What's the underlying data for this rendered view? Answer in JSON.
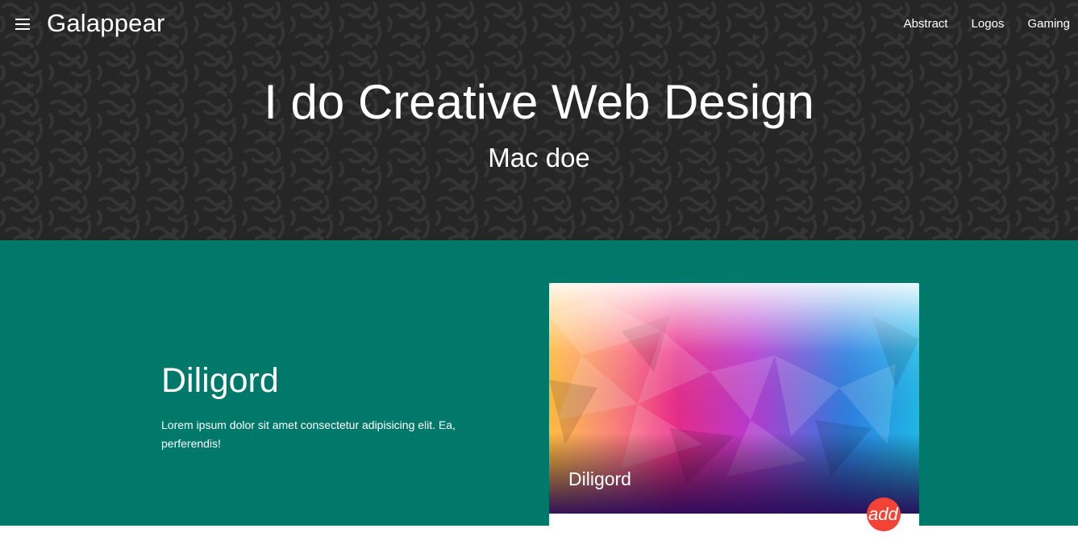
{
  "header": {
    "brand": "Galappear",
    "nav": [
      "Abstract",
      "Logos",
      "Gaming"
    ]
  },
  "hero": {
    "title": "I do Creative Web Design",
    "subtitle": "Mac doe"
  },
  "feature": {
    "title": "Diligord",
    "text": "Lorem ipsum dolor sit amet consectetur adipisicing elit. Ea, perferendis!",
    "card": {
      "caption": "Diligord",
      "fab_label": "add"
    }
  },
  "colors": {
    "hero_background": "#262626",
    "feature_background": "#00796b",
    "fab": "#f44336"
  },
  "icons": {
    "menu": "menu-icon"
  }
}
